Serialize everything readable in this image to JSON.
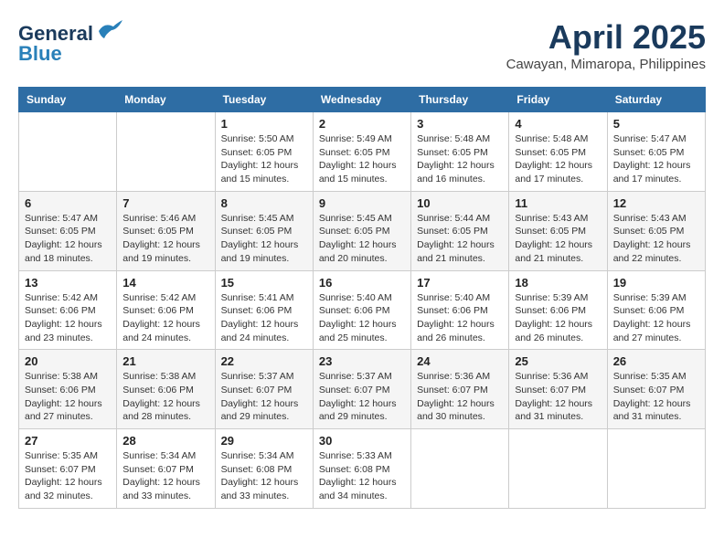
{
  "header": {
    "logo_line1": "General",
    "logo_line2": "Blue",
    "title": "April 2025",
    "subtitle": "Cawayan, Mimaropa, Philippines"
  },
  "days_of_week": [
    "Sunday",
    "Monday",
    "Tuesday",
    "Wednesday",
    "Thursday",
    "Friday",
    "Saturday"
  ],
  "weeks": [
    [
      {
        "day": "",
        "info": ""
      },
      {
        "day": "",
        "info": ""
      },
      {
        "day": "1",
        "info": "Sunrise: 5:50 AM\nSunset: 6:05 PM\nDaylight: 12 hours and 15 minutes."
      },
      {
        "day": "2",
        "info": "Sunrise: 5:49 AM\nSunset: 6:05 PM\nDaylight: 12 hours and 15 minutes."
      },
      {
        "day": "3",
        "info": "Sunrise: 5:48 AM\nSunset: 6:05 PM\nDaylight: 12 hours and 16 minutes."
      },
      {
        "day": "4",
        "info": "Sunrise: 5:48 AM\nSunset: 6:05 PM\nDaylight: 12 hours and 17 minutes."
      },
      {
        "day": "5",
        "info": "Sunrise: 5:47 AM\nSunset: 6:05 PM\nDaylight: 12 hours and 17 minutes."
      }
    ],
    [
      {
        "day": "6",
        "info": "Sunrise: 5:47 AM\nSunset: 6:05 PM\nDaylight: 12 hours and 18 minutes."
      },
      {
        "day": "7",
        "info": "Sunrise: 5:46 AM\nSunset: 6:05 PM\nDaylight: 12 hours and 19 minutes."
      },
      {
        "day": "8",
        "info": "Sunrise: 5:45 AM\nSunset: 6:05 PM\nDaylight: 12 hours and 19 minutes."
      },
      {
        "day": "9",
        "info": "Sunrise: 5:45 AM\nSunset: 6:05 PM\nDaylight: 12 hours and 20 minutes."
      },
      {
        "day": "10",
        "info": "Sunrise: 5:44 AM\nSunset: 6:05 PM\nDaylight: 12 hours and 21 minutes."
      },
      {
        "day": "11",
        "info": "Sunrise: 5:43 AM\nSunset: 6:05 PM\nDaylight: 12 hours and 21 minutes."
      },
      {
        "day": "12",
        "info": "Sunrise: 5:43 AM\nSunset: 6:05 PM\nDaylight: 12 hours and 22 minutes."
      }
    ],
    [
      {
        "day": "13",
        "info": "Sunrise: 5:42 AM\nSunset: 6:06 PM\nDaylight: 12 hours and 23 minutes."
      },
      {
        "day": "14",
        "info": "Sunrise: 5:42 AM\nSunset: 6:06 PM\nDaylight: 12 hours and 24 minutes."
      },
      {
        "day": "15",
        "info": "Sunrise: 5:41 AM\nSunset: 6:06 PM\nDaylight: 12 hours and 24 minutes."
      },
      {
        "day": "16",
        "info": "Sunrise: 5:40 AM\nSunset: 6:06 PM\nDaylight: 12 hours and 25 minutes."
      },
      {
        "day": "17",
        "info": "Sunrise: 5:40 AM\nSunset: 6:06 PM\nDaylight: 12 hours and 26 minutes."
      },
      {
        "day": "18",
        "info": "Sunrise: 5:39 AM\nSunset: 6:06 PM\nDaylight: 12 hours and 26 minutes."
      },
      {
        "day": "19",
        "info": "Sunrise: 5:39 AM\nSunset: 6:06 PM\nDaylight: 12 hours and 27 minutes."
      }
    ],
    [
      {
        "day": "20",
        "info": "Sunrise: 5:38 AM\nSunset: 6:06 PM\nDaylight: 12 hours and 27 minutes."
      },
      {
        "day": "21",
        "info": "Sunrise: 5:38 AM\nSunset: 6:06 PM\nDaylight: 12 hours and 28 minutes."
      },
      {
        "day": "22",
        "info": "Sunrise: 5:37 AM\nSunset: 6:07 PM\nDaylight: 12 hours and 29 minutes."
      },
      {
        "day": "23",
        "info": "Sunrise: 5:37 AM\nSunset: 6:07 PM\nDaylight: 12 hours and 29 minutes."
      },
      {
        "day": "24",
        "info": "Sunrise: 5:36 AM\nSunset: 6:07 PM\nDaylight: 12 hours and 30 minutes."
      },
      {
        "day": "25",
        "info": "Sunrise: 5:36 AM\nSunset: 6:07 PM\nDaylight: 12 hours and 31 minutes."
      },
      {
        "day": "26",
        "info": "Sunrise: 5:35 AM\nSunset: 6:07 PM\nDaylight: 12 hours and 31 minutes."
      }
    ],
    [
      {
        "day": "27",
        "info": "Sunrise: 5:35 AM\nSunset: 6:07 PM\nDaylight: 12 hours and 32 minutes."
      },
      {
        "day": "28",
        "info": "Sunrise: 5:34 AM\nSunset: 6:07 PM\nDaylight: 12 hours and 33 minutes."
      },
      {
        "day": "29",
        "info": "Sunrise: 5:34 AM\nSunset: 6:08 PM\nDaylight: 12 hours and 33 minutes."
      },
      {
        "day": "30",
        "info": "Sunrise: 5:33 AM\nSunset: 6:08 PM\nDaylight: 12 hours and 34 minutes."
      },
      {
        "day": "",
        "info": ""
      },
      {
        "day": "",
        "info": ""
      },
      {
        "day": "",
        "info": ""
      }
    ]
  ]
}
